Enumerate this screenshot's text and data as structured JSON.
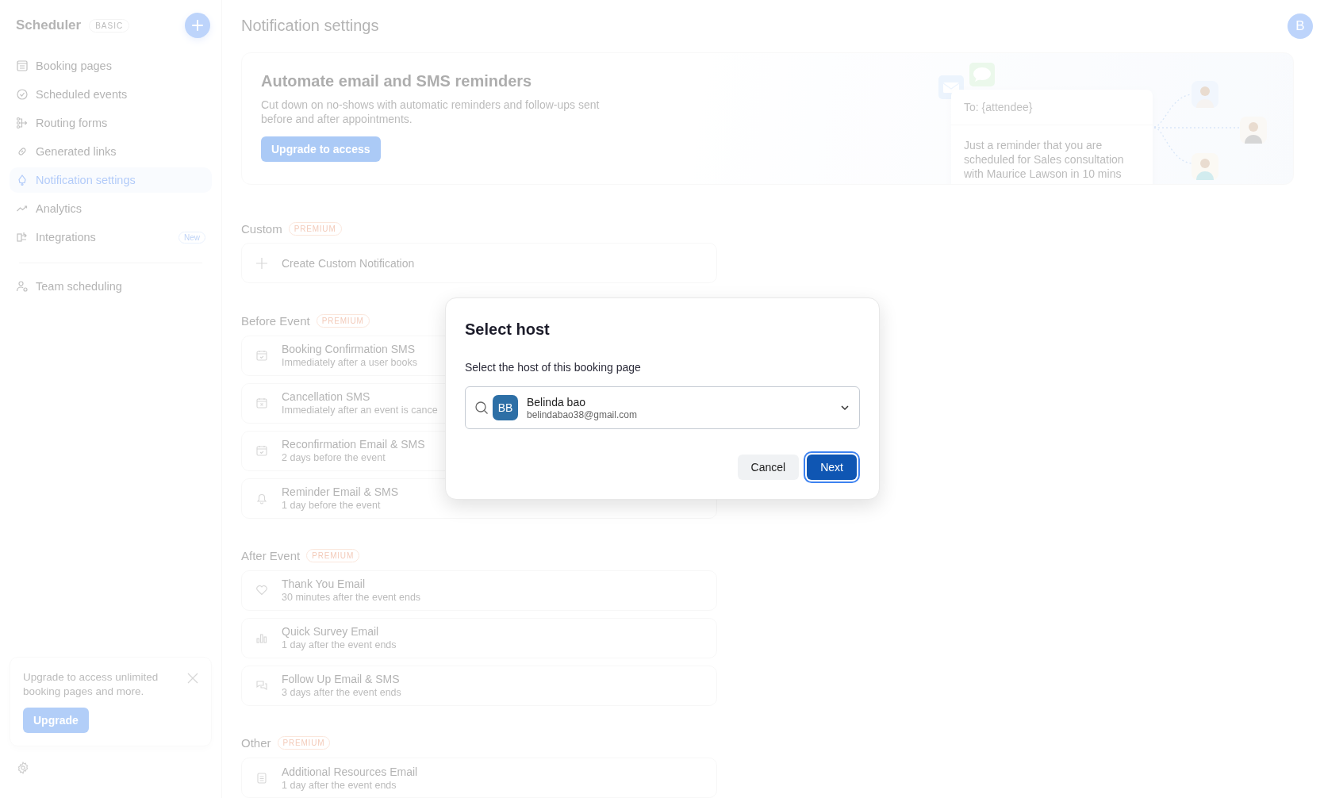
{
  "sidebar": {
    "app_name": "Scheduler",
    "plan_badge": "BASIC",
    "items": [
      {
        "label": "Booking pages",
        "selected": false
      },
      {
        "label": "Scheduled events",
        "selected": false
      },
      {
        "label": "Routing forms",
        "selected": false
      },
      {
        "label": "Generated links",
        "selected": false
      },
      {
        "label": "Notification settings",
        "selected": true
      },
      {
        "label": "Analytics",
        "selected": false
      },
      {
        "label": "Integrations",
        "selected": false,
        "badge": "New"
      }
    ],
    "secondary_items": [
      {
        "label": "Team scheduling",
        "selected": false
      }
    ],
    "upgrade_card": {
      "text": "Upgrade to access unlimited booking pages and more.",
      "button": "Upgrade"
    }
  },
  "header": {
    "title": "Notification settings",
    "avatar": "B"
  },
  "banner": {
    "title": "Automate email and SMS reminders",
    "text": "Cut down on no-shows with automatic reminders and follow-ups sent before and after appointments.",
    "button": "Upgrade to access",
    "preview": {
      "to": "To: {attendee}",
      "message": "Just a reminder that you are scheduled for Sales consultation with Maurice Lawson in 10 mins"
    }
  },
  "sections": [
    {
      "title": "Custom",
      "badge": "PREMIUM",
      "items": [
        {
          "kind": "create",
          "title": "Create Custom Notification"
        }
      ]
    },
    {
      "title": "Before Event",
      "badge": "PREMIUM",
      "items": [
        {
          "kind": "notification",
          "title": "Booking Confirmation SMS",
          "subtitle": "Immediately after a user books"
        },
        {
          "kind": "notification",
          "title": "Cancellation SMS",
          "subtitle": "Immediately after an event is cance"
        },
        {
          "kind": "notification",
          "title": "Reconfirmation Email & SMS",
          "subtitle": "2 days before the event"
        },
        {
          "kind": "notification",
          "title": "Reminder Email & SMS",
          "subtitle": "1 day before the event"
        }
      ]
    },
    {
      "title": "After Event",
      "badge": "PREMIUM",
      "items": [
        {
          "kind": "notification",
          "title": "Thank You Email",
          "subtitle": "30 minutes after the event ends"
        },
        {
          "kind": "notification",
          "title": "Quick Survey Email",
          "subtitle": "1 day after the event ends"
        },
        {
          "kind": "notification",
          "title": "Follow Up Email & SMS",
          "subtitle": "3 days after the event ends"
        }
      ]
    },
    {
      "title": "Other",
      "badge": "PREMIUM",
      "items": [
        {
          "kind": "notification",
          "title": "Additional Resources Email",
          "subtitle": "1 day after the event ends"
        }
      ]
    }
  ],
  "dialog": {
    "title": "Select host",
    "label": "Select the host of this booking page",
    "host": {
      "initials": "BB",
      "name": "Belinda bao",
      "email": "belindabao38@gmail.com"
    },
    "buttons": [
      {
        "label": "Cancel",
        "kind": "secondary"
      },
      {
        "label": "Next",
        "kind": "primary"
      }
    ]
  }
}
